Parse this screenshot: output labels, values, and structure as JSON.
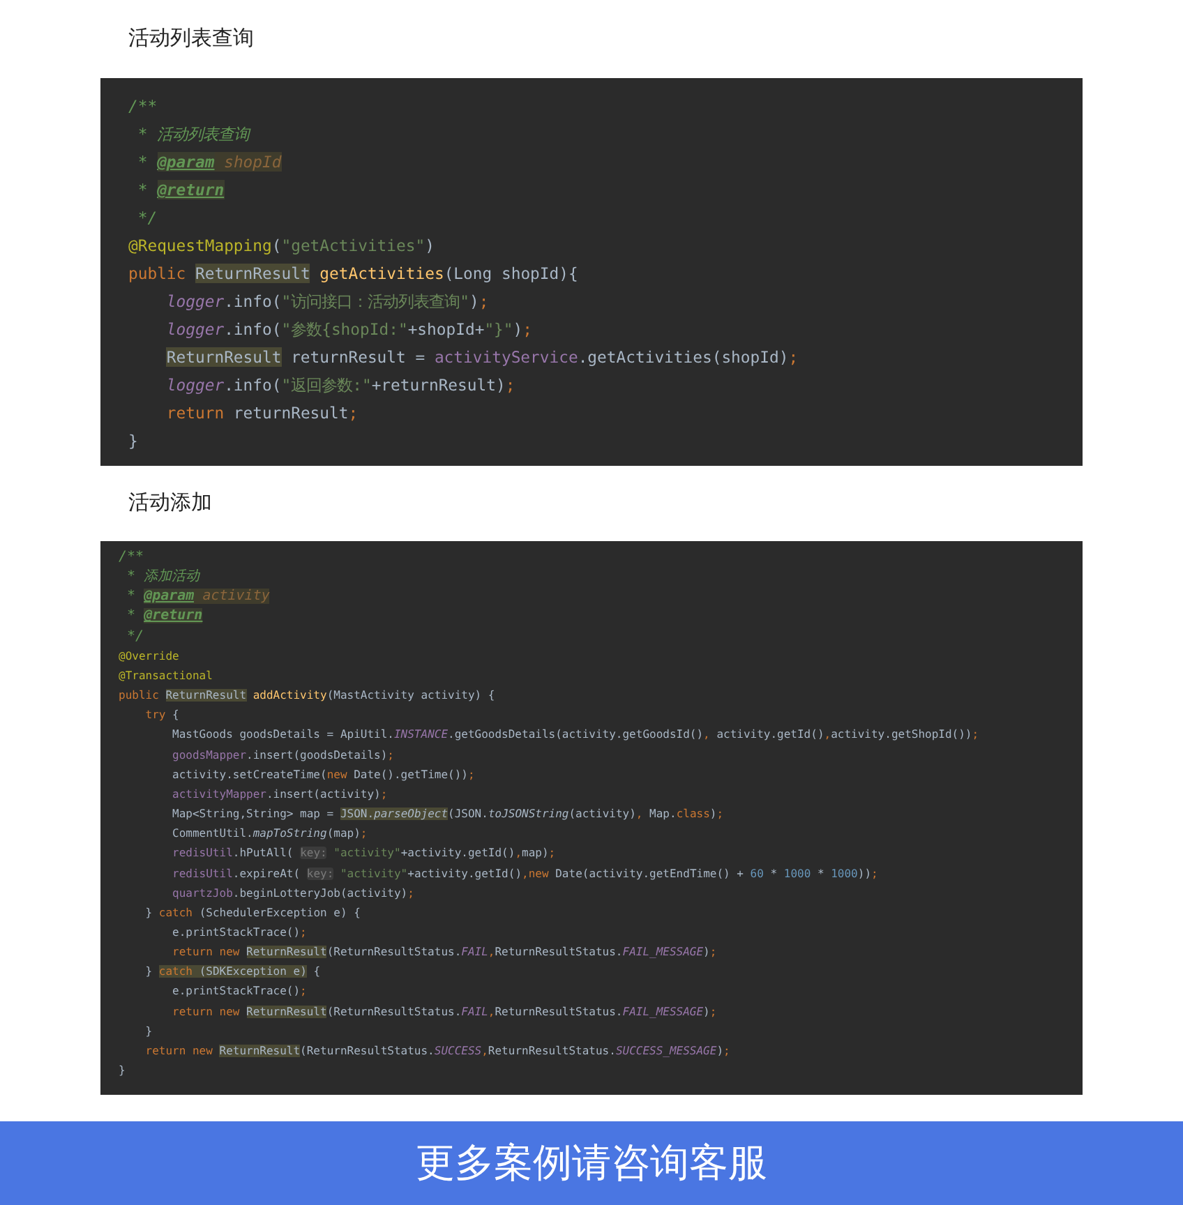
{
  "sections": [
    {
      "title": "活动列表查询",
      "code": {
        "lines": [
          {
            "tokens": [
              {
                "text": "/**",
                "kind": "comment"
              }
            ]
          },
          {
            "tokens": [
              {
                "text": " * 活动列表查询",
                "kind": "comment"
              }
            ]
          },
          {
            "tokens": [
              {
                "text": " * ",
                "kind": "comment"
              },
              {
                "text": "@param",
                "kind": "doctag"
              },
              {
                "text": " shopId",
                "kind": "docparam"
              }
            ]
          },
          {
            "tokens": [
              {
                "text": " * ",
                "kind": "comment"
              },
              {
                "text": "@return",
                "kind": "doctag"
              }
            ]
          },
          {
            "tokens": [
              {
                "text": " */",
                "kind": "comment"
              }
            ]
          },
          {
            "tokens": [
              {
                "text": "@RequestMapping",
                "kind": "annotation"
              },
              {
                "text": "(",
                "kind": "plain"
              },
              {
                "text": "\"getActivities\"",
                "kind": "string"
              },
              {
                "text": ")",
                "kind": "plain"
              }
            ]
          },
          {
            "tokens": [
              {
                "text": "public ",
                "kind": "keyword"
              },
              {
                "text": "ReturnResult",
                "kind": "marked"
              },
              {
                "text": " getActivities",
                "kind": "method"
              },
              {
                "text": "(Long shopId){",
                "kind": "plain"
              }
            ],
            "children": [
              {
                "tokens": [
                  {
                    "text": "logger",
                    "kind": "constant"
                  },
                  {
                    "text": ".info(",
                    "kind": "plain"
                  },
                  {
                    "text": "\"访问接口：活动列表查询\"",
                    "kind": "string"
                  },
                  {
                    "text": ")",
                    "kind": "plain"
                  },
                  {
                    "text": ";",
                    "kind": "keyword"
                  }
                ]
              },
              {
                "tokens": [
                  {
                    "text": "logger",
                    "kind": "constant"
                  },
                  {
                    "text": ".info(",
                    "kind": "plain"
                  },
                  {
                    "text": "\"参数{shopId:\"",
                    "kind": "string"
                  },
                  {
                    "text": "+shopId+",
                    "kind": "plain"
                  },
                  {
                    "text": "\"}\"",
                    "kind": "string"
                  },
                  {
                    "text": ")",
                    "kind": "plain"
                  },
                  {
                    "text": ";",
                    "kind": "keyword"
                  }
                ]
              },
              {
                "tokens": [
                  {
                    "text": "ReturnResult",
                    "kind": "marked"
                  },
                  {
                    "text": " returnResult = ",
                    "kind": "plain"
                  },
                  {
                    "text": "activityService",
                    "kind": "field"
                  },
                  {
                    "text": ".getActivities(shopId)",
                    "kind": "plain"
                  },
                  {
                    "text": ";",
                    "kind": "keyword"
                  }
                ]
              },
              {
                "tokens": [
                  {
                    "text": "logger",
                    "kind": "constant"
                  },
                  {
                    "text": ".info(",
                    "kind": "plain"
                  },
                  {
                    "text": "\"返回参数:\"",
                    "kind": "string"
                  },
                  {
                    "text": "+returnResult)",
                    "kind": "plain"
                  },
                  {
                    "text": ";",
                    "kind": "keyword"
                  }
                ]
              },
              {
                "tokens": [
                  {
                    "text": "return",
                    "kind": "keyword"
                  },
                  {
                    "text": " returnResult",
                    "kind": "plain"
                  },
                  {
                    "text": ";",
                    "kind": "keyword"
                  }
                ]
              }
            ]
          },
          {
            "tokens": [
              {
                "text": "}",
                "kind": "plain"
              }
            ]
          }
        ]
      }
    },
    {
      "title": "活动添加",
      "code": {
        "lines": [
          {
            "tokens": [
              {
                "text": "/**",
                "kind": "comment"
              }
            ]
          },
          {
            "tokens": [
              {
                "text": " * 添加活动",
                "kind": "comment"
              }
            ]
          },
          {
            "tokens": [
              {
                "text": " * ",
                "kind": "comment"
              },
              {
                "text": "@param",
                "kind": "doctag"
              },
              {
                "text": " activity",
                "kind": "docparam"
              }
            ]
          },
          {
            "tokens": [
              {
                "text": " * ",
                "kind": "comment"
              },
              {
                "text": "@return",
                "kind": "doctag"
              }
            ]
          },
          {
            "tokens": [
              {
                "text": " */",
                "kind": "comment"
              }
            ]
          },
          {
            "tokens": [
              {
                "text": "@Override",
                "kind": "annotation"
              }
            ]
          },
          {
            "tokens": [
              {
                "text": "@Transactional",
                "kind": "annotation"
              }
            ]
          },
          {
            "tokens": [
              {
                "text": "public ",
                "kind": "keyword"
              },
              {
                "text": "ReturnResult",
                "kind": "marked"
              },
              {
                "text": " addActivity",
                "kind": "method"
              },
              {
                "text": "(MastActivity activity) {",
                "kind": "plain"
              }
            ],
            "children": [
              {
                "tokens": [
                  {
                    "text": "try",
                    "kind": "keyword"
                  },
                  {
                    "text": " {",
                    "kind": "plain"
                  }
                ],
                "children": [
                  {
                    "tokens": [
                      {
                        "text": "MastGoods goodsDetails = ApiUtil.",
                        "kind": "plain"
                      },
                      {
                        "text": "INSTANCE",
                        "kind": "constant"
                      },
                      {
                        "text": ".getGoodsDetails(activity.getGoodsId()",
                        "kind": "plain"
                      },
                      {
                        "text": ",",
                        "kind": "keyword"
                      },
                      {
                        "text": " activity.getId()",
                        "kind": "plain"
                      },
                      {
                        "text": ",",
                        "kind": "keyword"
                      },
                      {
                        "text": "activity.getShopId())",
                        "kind": "plain"
                      },
                      {
                        "text": ";",
                        "kind": "keyword"
                      }
                    ]
                  },
                  {
                    "tokens": [
                      {
                        "text": "goodsMapper",
                        "kind": "field"
                      },
                      {
                        "text": ".insert(goodsDetails)",
                        "kind": "plain"
                      },
                      {
                        "text": ";",
                        "kind": "keyword"
                      }
                    ]
                  },
                  {
                    "tokens": [
                      {
                        "text": "activity.setCreateTime(",
                        "kind": "plain"
                      },
                      {
                        "text": "new",
                        "kind": "keyword"
                      },
                      {
                        "text": " Date().getTime())",
                        "kind": "plain"
                      },
                      {
                        "text": ";",
                        "kind": "keyword"
                      }
                    ]
                  },
                  {
                    "tokens": [
                      {
                        "text": "activityMapper",
                        "kind": "field"
                      },
                      {
                        "text": ".insert(activity)",
                        "kind": "plain"
                      },
                      {
                        "text": ";",
                        "kind": "keyword"
                      }
                    ]
                  },
                  {
                    "tokens": [
                      {
                        "text": "Map<String,String> map = ",
                        "kind": "plain"
                      },
                      {
                        "text": "JSON.",
                        "kind": "markedplain"
                      },
                      {
                        "text": "parseObject",
                        "kind": "markeditalic"
                      },
                      {
                        "text": "(JSON.",
                        "kind": "plain"
                      },
                      {
                        "text": "toJSONString",
                        "kind": "italic"
                      },
                      {
                        "text": "(activity)",
                        "kind": "plain"
                      },
                      {
                        "text": ",",
                        "kind": "keyword"
                      },
                      {
                        "text": " Map.",
                        "kind": "plain"
                      },
                      {
                        "text": "class",
                        "kind": "keyword"
                      },
                      {
                        "text": ")",
                        "kind": "plain"
                      },
                      {
                        "text": ";",
                        "kind": "keyword"
                      }
                    ]
                  },
                  {
                    "tokens": [
                      {
                        "text": "CommentUtil.",
                        "kind": "plain"
                      },
                      {
                        "text": "mapToString",
                        "kind": "italic"
                      },
                      {
                        "text": "(map)",
                        "kind": "plain"
                      },
                      {
                        "text": ";",
                        "kind": "keyword"
                      }
                    ]
                  },
                  {
                    "tokens": [
                      {
                        "text": "redisUtil",
                        "kind": "field"
                      },
                      {
                        "text": ".hPutAll( ",
                        "kind": "plain"
                      },
                      {
                        "text": "key:",
                        "kind": "hint"
                      },
                      {
                        "text": " \"activity\"",
                        "kind": "string"
                      },
                      {
                        "text": "+activity.getId()",
                        "kind": "plain"
                      },
                      {
                        "text": ",",
                        "kind": "keyword"
                      },
                      {
                        "text": "map)",
                        "kind": "plain"
                      },
                      {
                        "text": ";",
                        "kind": "keyword"
                      }
                    ]
                  },
                  {
                    "tokens": [
                      {
                        "text": "redisUtil",
                        "kind": "field"
                      },
                      {
                        "text": ".expireAt( ",
                        "kind": "plain"
                      },
                      {
                        "text": "key:",
                        "kind": "hint"
                      },
                      {
                        "text": " \"activity\"",
                        "kind": "string"
                      },
                      {
                        "text": "+activity.getId()",
                        "kind": "plain"
                      },
                      {
                        "text": ",",
                        "kind": "keyword"
                      },
                      {
                        "text": "new",
                        "kind": "keyword"
                      },
                      {
                        "text": " Date(activity.getEndTime() + ",
                        "kind": "plain"
                      },
                      {
                        "text": "60",
                        "kind": "number"
                      },
                      {
                        "text": " * ",
                        "kind": "plain"
                      },
                      {
                        "text": "1000",
                        "kind": "number"
                      },
                      {
                        "text": " * ",
                        "kind": "plain"
                      },
                      {
                        "text": "1000",
                        "kind": "number"
                      },
                      {
                        "text": "))",
                        "kind": "plain"
                      },
                      {
                        "text": ";",
                        "kind": "keyword"
                      }
                    ]
                  },
                  {
                    "tokens": [
                      {
                        "text": "quartzJob",
                        "kind": "field"
                      },
                      {
                        "text": ".beginLotteryJob(activity)",
                        "kind": "plain"
                      },
                      {
                        "text": ";",
                        "kind": "keyword"
                      }
                    ]
                  }
                ]
              },
              {
                "tokens": [
                  {
                    "text": "} ",
                    "kind": "plain"
                  },
                  {
                    "text": "catch",
                    "kind": "keyword"
                  },
                  {
                    "text": " (SchedulerException e) {",
                    "kind": "plain"
                  }
                ],
                "children": [
                  {
                    "tokens": [
                      {
                        "text": "e.printStackTrace()",
                        "kind": "plain"
                      },
                      {
                        "text": ";",
                        "kind": "keyword"
                      }
                    ]
                  },
                  {
                    "tokens": [
                      {
                        "text": "return new ",
                        "kind": "keyword"
                      },
                      {
                        "text": "ReturnResult",
                        "kind": "marked"
                      },
                      {
                        "text": "(ReturnResultStatus.",
                        "kind": "plain"
                      },
                      {
                        "text": "FAIL",
                        "kind": "constant"
                      },
                      {
                        "text": ",",
                        "kind": "keyword"
                      },
                      {
                        "text": "ReturnResultStatus.",
                        "kind": "plain"
                      },
                      {
                        "text": "FAIL_MESSAGE",
                        "kind": "constant"
                      },
                      {
                        "text": ")",
                        "kind": "plain"
                      },
                      {
                        "text": ";",
                        "kind": "keyword"
                      }
                    ]
                  }
                ]
              },
              {
                "tokens": [
                  {
                    "text": "} ",
                    "kind": "plain"
                  },
                  {
                    "text": "catch",
                    "kind": "keywordmarked"
                  },
                  {
                    "text": " (SDKException e)",
                    "kind": "markedplain"
                  },
                  {
                    "text": " {",
                    "kind": "plain"
                  }
                ],
                "children": [
                  {
                    "tokens": [
                      {
                        "text": "e.printStackTrace()",
                        "kind": "plain"
                      },
                      {
                        "text": ";",
                        "kind": "keyword"
                      }
                    ]
                  },
                  {
                    "tokens": [
                      {
                        "text": "return new ",
                        "kind": "keyword"
                      },
                      {
                        "text": "ReturnResult",
                        "kind": "marked"
                      },
                      {
                        "text": "(ReturnResultStatus.",
                        "kind": "plain"
                      },
                      {
                        "text": "FAIL",
                        "kind": "constant"
                      },
                      {
                        "text": ",",
                        "kind": "keyword"
                      },
                      {
                        "text": "ReturnResultStatus.",
                        "kind": "plain"
                      },
                      {
                        "text": "FAIL_MESSAGE",
                        "kind": "constant"
                      },
                      {
                        "text": ")",
                        "kind": "plain"
                      },
                      {
                        "text": ";",
                        "kind": "keyword"
                      }
                    ]
                  }
                ]
              },
              {
                "tokens": [
                  {
                    "text": "}",
                    "kind": "plain"
                  }
                ]
              },
              {
                "tokens": [
                  {
                    "text": "return new ",
                    "kind": "keyword"
                  },
                  {
                    "text": "ReturnResult",
                    "kind": "marked"
                  },
                  {
                    "text": "(ReturnResultStatus.",
                    "kind": "plain"
                  },
                  {
                    "text": "SUCCESS",
                    "kind": "constant"
                  },
                  {
                    "text": ",",
                    "kind": "keyword"
                  },
                  {
                    "text": "ReturnResultStatus.",
                    "kind": "plain"
                  },
                  {
                    "text": "SUCCESS_MESSAGE",
                    "kind": "constant"
                  },
                  {
                    "text": ")",
                    "kind": "plain"
                  },
                  {
                    "text": ";",
                    "kind": "keyword"
                  }
                ]
              }
            ]
          },
          {
            "tokens": [
              {
                "text": "}",
                "kind": "plain"
              }
            ]
          }
        ]
      }
    }
  ],
  "banner": {
    "text": "更多案例请咨询客服"
  }
}
